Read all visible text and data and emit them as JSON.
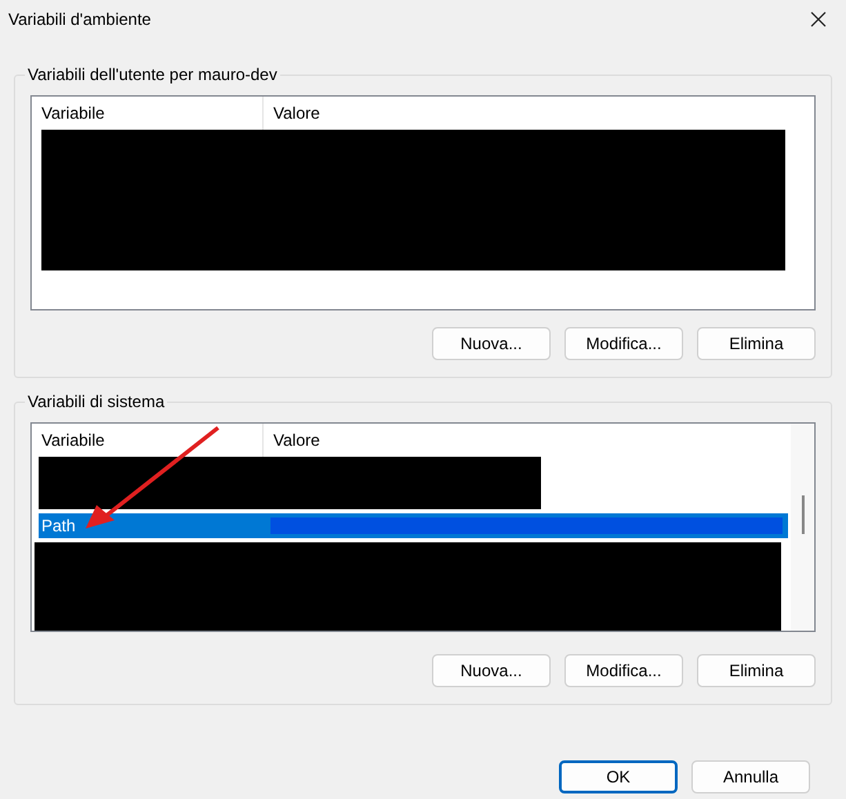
{
  "window": {
    "title": "Variabili d'ambiente"
  },
  "user_variables": {
    "title": "Variabili dell'utente per mauro-dev",
    "columns": [
      "Variabile",
      "Valore"
    ],
    "buttons": [
      "Nuova...",
      "Modifica...",
      "Elimina"
    ]
  },
  "system_variables": {
    "title": "Variabili di sistema",
    "columns": [
      "Variabile",
      "Valore"
    ],
    "rows": [
      {
        "variable": "Path",
        "selected": true
      }
    ],
    "buttons": [
      "Nuova...",
      "Modifica...",
      "Elimina"
    ]
  },
  "footer_buttons": [
    {
      "label": "OK",
      "kind": "default"
    },
    {
      "label": "Annulla",
      "kind": "normal"
    }
  ]
}
